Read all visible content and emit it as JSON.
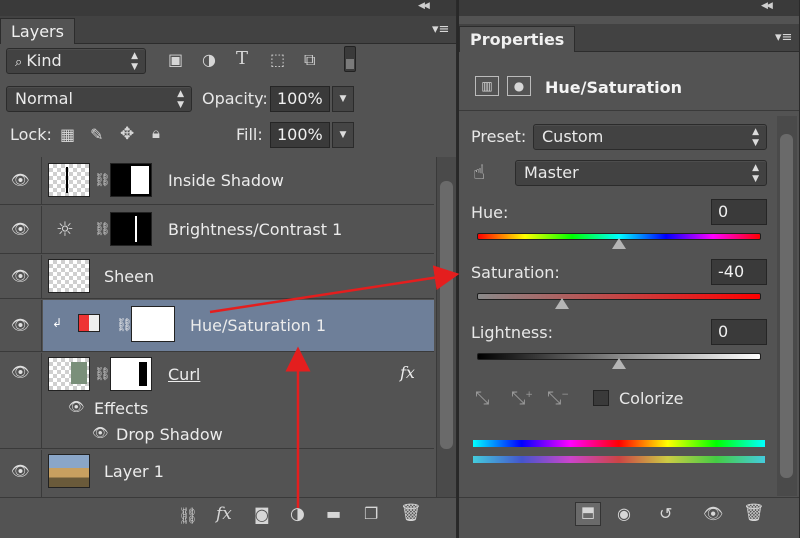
{
  "layers_panel": {
    "tab_label": "Layers",
    "filter_kind": "Kind",
    "blend_mode": "Normal",
    "opacity_label": "Opacity:",
    "opacity_value": "100%",
    "lock_label": "Lock:",
    "fill_label": "Fill:",
    "fill_value": "100%",
    "layers": [
      {
        "name": "Inside Shadow"
      },
      {
        "name": "Brightness/Contrast 1"
      },
      {
        "name": "Sheen"
      },
      {
        "name": "Hue/Saturation 1",
        "selected": true
      },
      {
        "name": "Curl",
        "fx": "fx",
        "effects_label": "Effects",
        "effect_item": "Drop Shadow"
      },
      {
        "name": "Layer 1"
      }
    ]
  },
  "properties_panel": {
    "tab_label": "Properties",
    "adjustment_title": "Hue/Saturation",
    "preset_label": "Preset:",
    "preset_value": "Custom",
    "channel_value": "Master",
    "hue_label": "Hue:",
    "hue_value": "0",
    "hue_fraction": 0.5,
    "saturation_label": "Saturation:",
    "saturation_value": "-40",
    "saturation_fraction": 0.3,
    "lightness_label": "Lightness:",
    "lightness_value": "0",
    "lightness_fraction": 0.5,
    "colorize_label": "Colorize",
    "colorize_checked": false
  },
  "colors": {
    "selected_row": "#6e7f99",
    "annotation_arrow": "#e41e1e"
  }
}
